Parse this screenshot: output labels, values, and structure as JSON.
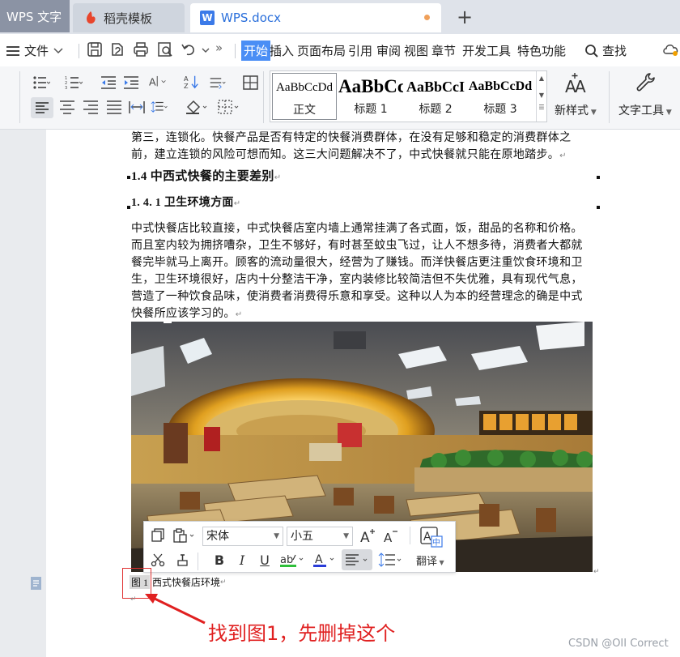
{
  "tabs": {
    "app": "WPS 文字",
    "template": "稻壳模板",
    "doc": "WPS.docx"
  },
  "menu": {
    "file": "文件",
    "items": [
      "开始",
      "插入",
      "页面布局",
      "引用",
      "审阅",
      "视图",
      "章节",
      "开发工具",
      "特色功能"
    ],
    "search": "查找",
    "more": "»"
  },
  "ribbon": {
    "styles": [
      {
        "sample": "AaBbCcDd",
        "name": "正文"
      },
      {
        "sample": "AaBbCc",
        "name": "标题 1"
      },
      {
        "sample": "AaBbCcI",
        "name": "标题 2"
      },
      {
        "sample": "AaBbCcDd",
        "name": "标题 3"
      }
    ],
    "new_style": "新样式",
    "text_tools": "文字工具"
  },
  "document": {
    "para_top": "第三，连锁化。快餐产品是否有特定的快餐消费群体，在没有足够和稳定的消费群体之前，建立连锁的风险可想而知。这三大问题解决不了，中式快餐就只能在原地踏步。",
    "heading_1_4": "1.4  中西式快餐的主要差别",
    "heading_1_4_1": "1. 4. 1  卫生环境方面",
    "para_main": "中式快餐店比较直接，中式快餐店室内墙上通常挂满了各式面，饭，甜品的名称和价格。而且室内较为拥挤嘈杂，卫生不够好，有时甚至蚊虫飞过，让人不想多待，消费者大都就餐完毕就马上离开。顾客的流动量很大，经营为了赚钱。而洋快餐店更注重饮食环境和卫生，卫生环境很好，店内十分整洁干净，室内装修比较简洁但不失优雅，具有现代气息，营造了一种饮食品味，使消费者消费得乐意和享受。这种以人为本的经营理念的确是中式快餐所应该学习的。",
    "caption_label": "图 1",
    "caption_text": "西式快餐店环境",
    "pilcrow": "↵"
  },
  "mini_toolbar": {
    "font": "宋体",
    "size": "小五",
    "translate": "翻译"
  },
  "annotation": "找到图1，先删掉这个",
  "watermark": "CSDN @OII Correct",
  "colors": {
    "accent": "#4a8ef5",
    "annotation": "#e02020",
    "tab_active_text": "#2a6fdb"
  }
}
